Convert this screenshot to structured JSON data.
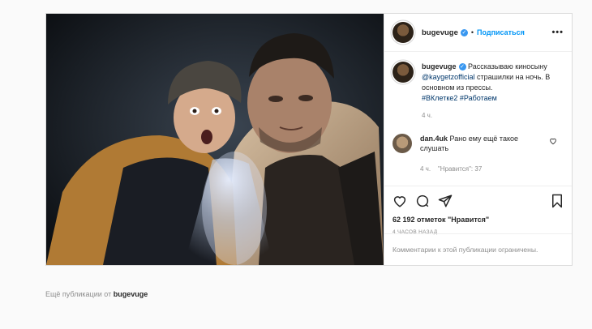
{
  "post": {
    "username": "bugevuge",
    "verified_mark": "✓",
    "dot": "•",
    "follow_label": "Подписаться",
    "more_label": "•••",
    "caption": {
      "username": "bugevuge",
      "text_1": "Рассказываю киносыну",
      "mention": "@kaygetzofficial",
      "text_2": "страшилки на ночь. В основном из прессы.",
      "hashtag_1": "#ВКлетке2",
      "hashtag_2": "#Работаем",
      "time": "4 ч."
    },
    "comments": [
      {
        "username": "dan.4uk",
        "text": "Рано ему ещё такое слушать",
        "time": "4 ч.",
        "likes": "\"Нравится\": 37"
      }
    ],
    "likes_text": "62 192 отметок \"Нравится\"",
    "posted_ago": "4 ЧАСОВ НАЗАД",
    "comments_disabled": "Комментарии к этой публикации ограничены."
  },
  "more_posts": {
    "prefix": "Ещё публикации от",
    "username": "bugevuge"
  },
  "colors": {
    "link": "#00376b",
    "follow": "#0095f6",
    "secondary": "#8e8e8e",
    "verified": "#3897f0"
  },
  "icons": [
    "heart-icon",
    "comment-icon",
    "share-icon",
    "bookmark-icon",
    "more-icon",
    "verified-icon"
  ]
}
